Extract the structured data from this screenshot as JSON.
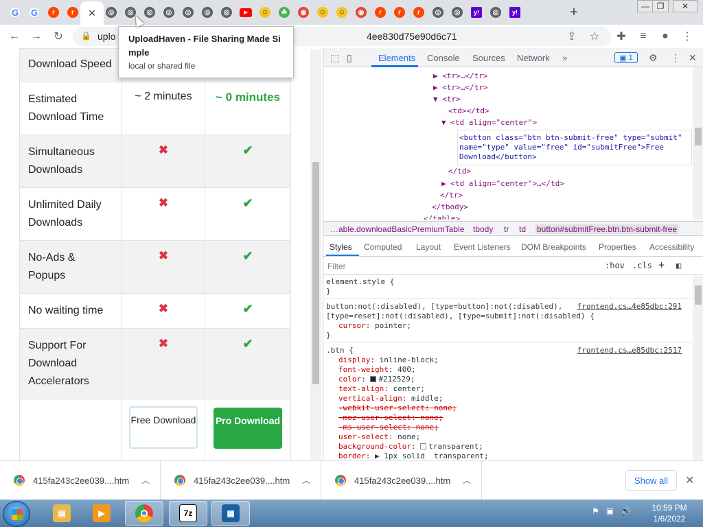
{
  "browser": {
    "tabs": [
      "G",
      "G",
      "r",
      "r",
      "active",
      "gl",
      "gl",
      "gl",
      "gl",
      "gl",
      "gl",
      "gl",
      "yt",
      "em",
      "tg",
      "rc",
      "em",
      "em",
      "rc",
      "r",
      "r",
      "r",
      "gl",
      "gl",
      "yh",
      "gl",
      "yh"
    ],
    "active_tab_close": "✕",
    "new_tab": "+",
    "window_controls": [
      "—",
      "❐",
      "✕"
    ],
    "url_start": "uplo",
    "url_end": "4ee830d75e90d6c71"
  },
  "tooltip": {
    "title": "UploadHaven - File Sharing Made Si mple",
    "subtitle": "local or shared file"
  },
  "page": {
    "rows": [
      {
        "feature": "Download Speed",
        "free": "",
        "pro": "",
        "alt": true
      },
      {
        "feature": "Estimated Download Time",
        "free": "~ 2 minutes",
        "pro": "~ 0 minutes",
        "alt": false
      },
      {
        "feature": "Simultaneous Downloads",
        "free": "✖",
        "pro": "✔",
        "alt": true
      },
      {
        "feature": "Unlimited Daily Downloads",
        "free": "✖",
        "pro": "✔",
        "alt": false
      },
      {
        "feature": "No-Ads & Popups",
        "free": "✖",
        "pro": "✔",
        "alt": true
      },
      {
        "feature": "No waiting time",
        "free": "✖",
        "pro": "✔",
        "alt": false
      },
      {
        "feature": "Support For Download Accelerators",
        "free": "✖",
        "pro": "✔",
        "alt": true
      }
    ],
    "free_button": "Free Download",
    "pro_button": "Pro Download",
    "colors": {
      "free_mark": "#dc3545",
      "pro_mark": "#28a745",
      "pro_button": "#28a745"
    }
  },
  "devtools": {
    "tabs": [
      "Elements",
      "Console",
      "Sources",
      "Network",
      "»"
    ],
    "issues_badge": "1",
    "dom_lines": [
      "▶ <tr>…</tr>",
      "▶ <tr>…</tr>",
      "▼ <tr>",
      "<td></td>",
      "▼ <td align=\"center\">",
      "<button class=\"btn btn-submit-free\" type=\"submit\"",
      "name=\"type\" value=\"free\" id=\"submitFree\">Free",
      "Download</button>",
      "</td>",
      "▶ <td align=\"center\">…</td>",
      "</tr>",
      "</tbody>",
      "</table>"
    ],
    "breadcrumbs": [
      "…",
      "able.downloadBasicPremiumTable",
      "tbody",
      "tr",
      "td",
      "button#submitFree.btn.btn-submit-free"
    ],
    "subtabs": [
      "Styles",
      "Computed",
      "Layout",
      "Event Listeners",
      "DOM Breakpoints",
      "Properties",
      "Accessibility"
    ],
    "filter_placeholder": "Filter",
    "filter_hov": ":hov",
    "filter_cls": ".cls",
    "filter_plus": "+",
    "rules": {
      "element_style": "element.style {",
      "close": "}",
      "button_selector_1": "button:not(:disabled), [type=button]:not(:disabled),",
      "button_selector_2": "[type=reset]:not(:disabled), [type=submit]:not(:disabled) {",
      "button_source": "frontend.cs…4e85dbc:291",
      "cursor_prop": "cursor",
      "cursor_val": "pointer;",
      "btn_selector": ".btn {",
      "btn_source": "frontend.cs…e85dbc:2517",
      "btn_props": [
        {
          "p": "display",
          "v": "inline-block;",
          "strike": false
        },
        {
          "p": "font-weight",
          "v": "400;",
          "strike": false
        },
        {
          "p": "color",
          "v": "#212529;",
          "strike": false
        },
        {
          "p": "text-align",
          "v": "center;",
          "strike": false
        },
        {
          "p": "vertical-align",
          "v": "middle;",
          "strike": false
        },
        {
          "p": "-webkit-user-select",
          "v": "none;",
          "strike": true
        },
        {
          "p": "-moz-user-select",
          "v": "none;",
          "strike": true
        },
        {
          "p": "-ms-user-select",
          "v": "none;",
          "strike": true
        },
        {
          "p": "user-select",
          "v": "none;",
          "strike": false
        },
        {
          "p": "background-color",
          "v": "transparent;",
          "strike": false
        },
        {
          "p": "border",
          "v": "▶ 1px solid  transparent;",
          "strike": false
        }
      ]
    }
  },
  "downloads": {
    "items": [
      "415fa243c2ee039....htm",
      "415fa243c2ee039....htm",
      "415fa243c2ee039....htm"
    ],
    "show_all": "Show all",
    "close": "✕"
  },
  "taskbar": {
    "time": "10:59 PM",
    "date": "1/6/2022",
    "apps": [
      "explorer",
      "media",
      "chrome",
      "7z",
      "virtualbox"
    ],
    "app_7z_label": "7z"
  }
}
